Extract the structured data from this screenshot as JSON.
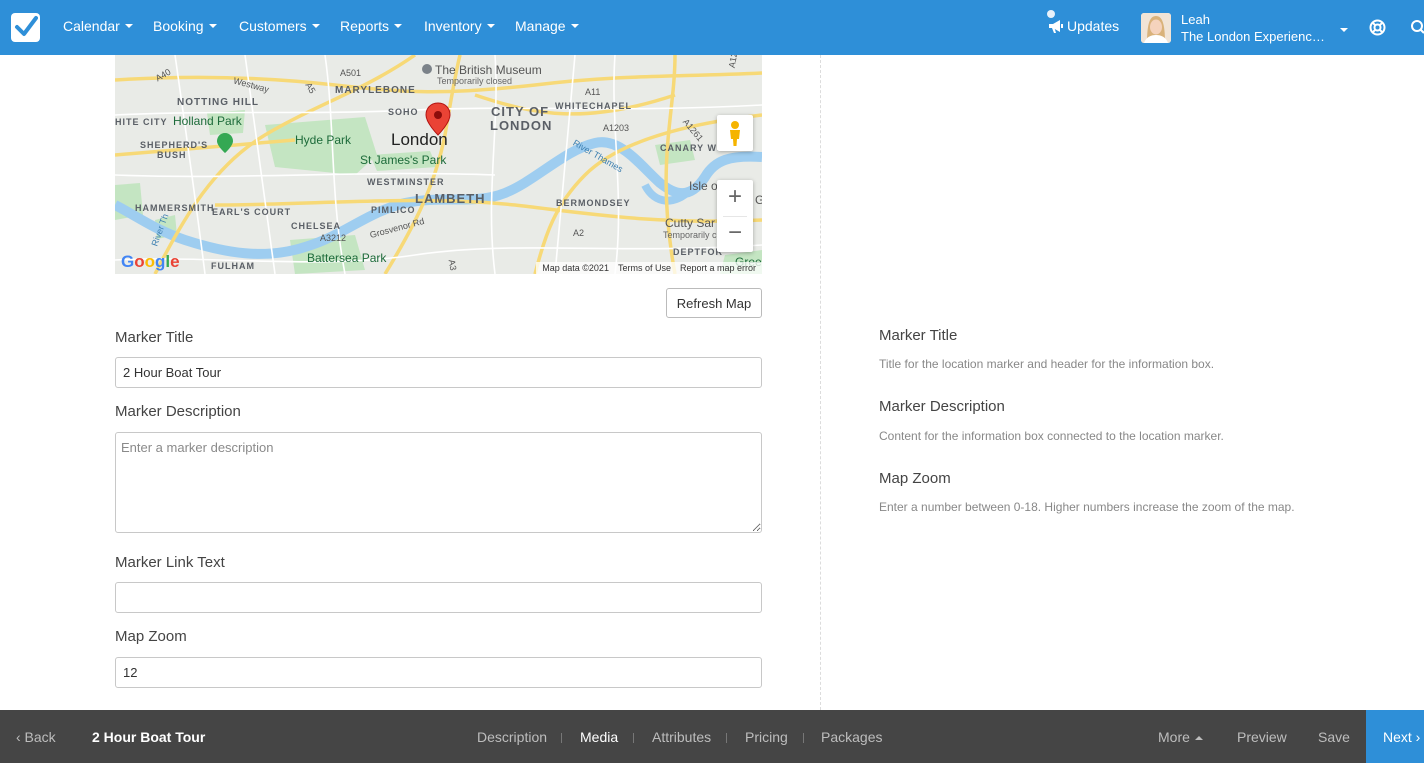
{
  "nav": {
    "items": [
      "Calendar",
      "Booking",
      "Customers",
      "Reports",
      "Inventory",
      "Manage"
    ],
    "updates_label": "Updates",
    "user_name": "Leah",
    "user_org": "The London Experienc…"
  },
  "map": {
    "labels": {
      "british_museum": "The British Museum",
      "temporarily_closed": "Temporarily closed",
      "marylebone": "MARYLEBONE",
      "soho": "SOHO",
      "notting_hill": "NOTTING HILL",
      "white_city": "HITE CITY",
      "holland_park": "Holland Park",
      "hyde_park": "Hyde Park",
      "london": "London",
      "city_of": "CITY OF",
      "city_london": "LONDON",
      "whitechapel": "WHITECHAPEL",
      "shepherds": "SHEPHERD'S",
      "bush": "BUSH",
      "st_james_park": "St James's Park",
      "westminster": "WESTMINSTER",
      "lambeth": "LAMBETH",
      "canary": "CANARY WH",
      "isle": "Isle o",
      "river_thames": "River Thames",
      "hammersmith": "HAMMERSMITH",
      "earls_court": "EARL'S COURT",
      "pimlico": "PIMLICO",
      "bermondsey": "BERMONDSEY",
      "chelsea": "CHELSEA",
      "cutty_sark": "Cutty Sar",
      "cutty_closed": "Temporarily close",
      "deptford": "DEPTFOR",
      "fulham": "FULHAM",
      "battersea_park": "Battersea Park",
      "westway": "Westway",
      "a501": "A501",
      "a11": "A11",
      "a1203": "A1203",
      "a1261": "A1261",
      "a3212": "A3212",
      "a2": "A2",
      "a3": "A3",
      "a12": "A12",
      "a5": "A5",
      "a40": "A40",
      "grosvenor": "Grosvenor Rd",
      "gree": "Greer",
      "river_side": "River Th",
      "g_edge": "G"
    },
    "google_logo": "Google",
    "attribution": {
      "map_data": "Map data ©2021",
      "terms": "Terms of Use",
      "report": "Report a map error"
    },
    "zoom_in": "+",
    "zoom_out": "−"
  },
  "form": {
    "refresh_label": "Refresh Map",
    "marker_title_label": "Marker Title",
    "marker_title_value": "2 Hour Boat Tour",
    "marker_description_label": "Marker Description",
    "marker_description_placeholder": "Enter a marker description",
    "marker_link_text_label": "Marker Link Text",
    "marker_link_text_value": "",
    "map_zoom_label": "Map Zoom",
    "map_zoom_value": "12"
  },
  "help": {
    "marker_title": "Marker Title",
    "marker_title_text": "Title for the location marker and header for the information box.",
    "marker_description": "Marker Description",
    "marker_description_text": "Content for the information box connected to the location marker.",
    "map_zoom": "Map Zoom",
    "map_zoom_text": "Enter a number between 0-18. Higher numbers increase the zoom of the map."
  },
  "bottom": {
    "back": "‹ Back",
    "title": "2 Hour Boat Tour",
    "tabs": [
      "Description",
      "Media",
      "Attributes",
      "Pricing",
      "Packages"
    ],
    "active_tab": "Media",
    "more": "More",
    "preview": "Preview",
    "save": "Save",
    "next": "Next ›"
  },
  "colors": {
    "brand_blue": "#2e8fd8",
    "bottom_bar": "#454545",
    "marker_red": "#ea4335"
  }
}
